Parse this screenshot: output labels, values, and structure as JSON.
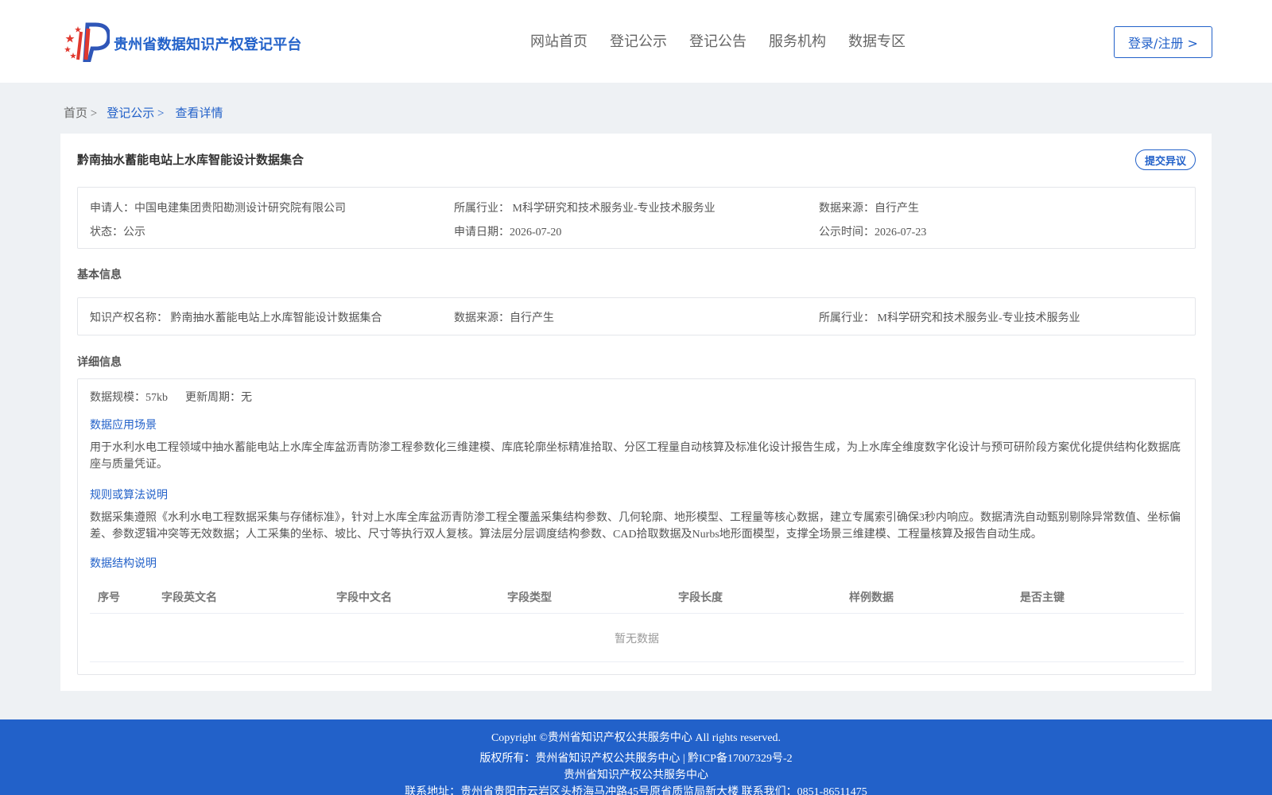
{
  "header": {
    "site_title": "贵州省数据知识产权登记平台",
    "nav": [
      "网站首页",
      "登记公示",
      "登记公告",
      "服务机构",
      "数据专区"
    ],
    "login_label": "登录/注册 >"
  },
  "breadcrumb": {
    "home": "首页 >",
    "registry": "登记公示 >",
    "current": "查看详情"
  },
  "record": {
    "title": "黔南抽水蓄能电站上水库智能设计数据集合",
    "objection_label": "提交异议",
    "applicant": "申请人：中国电建集团贵阳勘测设计研究院有限公司",
    "industry": "所属行业：  M科学研究和技术服务业-专业技术服务业",
    "source": "数据来源：自行产生",
    "status": "状态：公示",
    "apply_date": "申请日期：2026-07-20",
    "publish_date": "公示时间：2026-07-23"
  },
  "basic": {
    "section_title": "基本信息",
    "ip_name": "知识产权名称：  黔南抽水蓄能电站上水库智能设计数据集合",
    "source": "数据来源：自行产生",
    "industry": "所属行业：  M科学研究和技术服务业-专业技术服务业"
  },
  "detail": {
    "section_title": "详细信息",
    "scale": "数据规模：57kb",
    "update_cycle": "更新周期：无",
    "scenario_title": "数据应用场景",
    "scenario_text": "用于水利水电工程领域中抽水蓄能电站上水库全库盆沥青防渗工程参数化三维建模、库底轮廓坐标精准拾取、分区工程量自动核算及标准化设计报告生成，为上水库全维度数字化设计与预可研阶段方案优化提供结构化数据底座与质量凭证。",
    "rules_title": "规则或算法说明",
    "rules_text": "数据采集遵照《水利水电工程数据采集与存储标准》，针对上水库全库盆沥青防渗工程全覆盖采集结构参数、几何轮廓、地形模型、工程量等核心数据，建立专属索引确保3秒内响应。数据清洗自动甄别剔除异常数值、坐标偏差、参数逻辑冲突等无效数据；人工采集的坐标、坡比、尺寸等执行双人复核。算法层分层调度结构参数、CAD拾取数据及Nurbs地形面模型，支撑全场景三维建模、工程量核算及报告自动生成。",
    "structure_title": "数据结构说明",
    "table_headers": [
      "序号",
      "字段英文名",
      "字段中文名",
      "字段类型",
      "字段长度",
      "样例数据",
      "是否主键"
    ],
    "empty_text": "暂无数据"
  },
  "footer": {
    "copyright": "Copyright ©贵州省知识产权公共服务中心 All rights reserved.",
    "owner": "版权所有：贵州省知识产权公共服务中心 | 黔ICP备17007329号-2",
    "org": "贵州省知识产权公共服务中心",
    "contact": "联系地址：贵州省贵阳市云岩区头桥海马冲路45号原省质监局新大楼 联系我们：0851-86511475"
  },
  "colors": {
    "brand": "#2261c9",
    "logo_red": "#e0382e",
    "logo_blue": "#2f56b8"
  }
}
